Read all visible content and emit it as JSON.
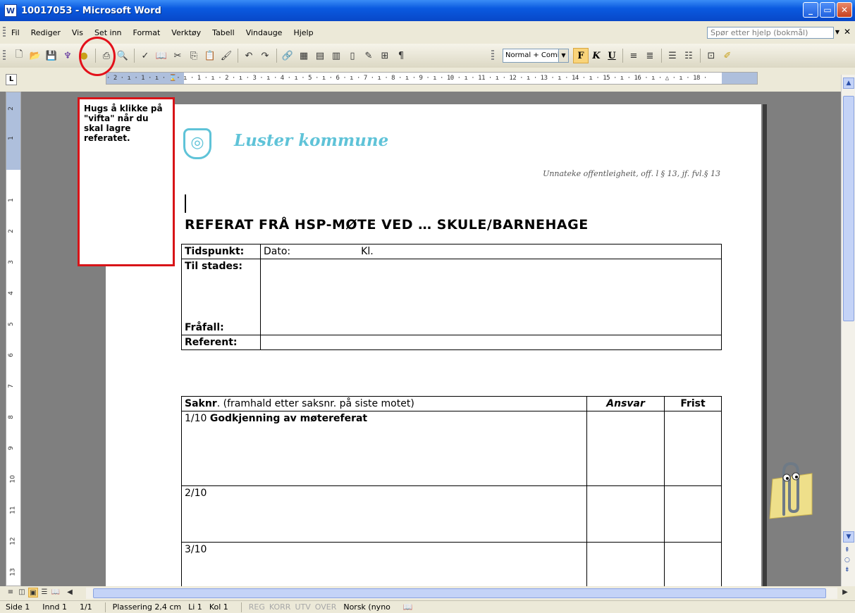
{
  "window": {
    "title": "10017053 - Microsoft Word"
  },
  "menu": {
    "items": [
      "Fil",
      "Rediger",
      "Vis",
      "Set inn",
      "Format",
      "Verktøy",
      "Tabell",
      "Vindauge",
      "Hjelp"
    ],
    "help_placeholder": "Spør etter hjelp (bokmål)"
  },
  "toolbar": {
    "style_value": "Normal + Comic",
    "bold_label": "F",
    "italic_label": "K",
    "underline_label": "U"
  },
  "annotation": {
    "note_text": "Hugs å klikke på \"vifta\" når du skal lagre referatet."
  },
  "document": {
    "org_name": "Luster kommune",
    "confidential": "Unnateke offentleigheit, off. l § 13, jf. fvl.§ 13",
    "title": "REFERAT FRÅ HSP-MØTE VED … SKULE/BARNEHAGE",
    "meta_table": {
      "tidspunkt": "Tidspunkt:",
      "dato": "Dato:",
      "kl": "Kl.",
      "til_stades": "Til stades:",
      "fraafall": "Fråfall:",
      "referent": "Referent:"
    },
    "agenda_table": {
      "header_saknr_bold": "Saknr",
      "header_saknr_rest": ". (framhald etter saksnr. på siste motet)",
      "header_ansvar": "Ansvar",
      "header_frist": "Frist",
      "rows": [
        {
          "nr": "1/10",
          "title": "Godkjenning av møtereferat"
        },
        {
          "nr": "2/10",
          "title": ""
        },
        {
          "nr": "3/10",
          "title": ""
        }
      ]
    }
  },
  "statusbar": {
    "side": "Side 1",
    "innd": "Innd 1",
    "pages": "1/1",
    "plassering": "Plassering 2,4 cm",
    "li": "Li 1",
    "kol": "Kol 1",
    "reg": "REG",
    "korr": "KORR",
    "utv": "UTV",
    "over": "OVER",
    "lang": "Norsk (nyno"
  }
}
